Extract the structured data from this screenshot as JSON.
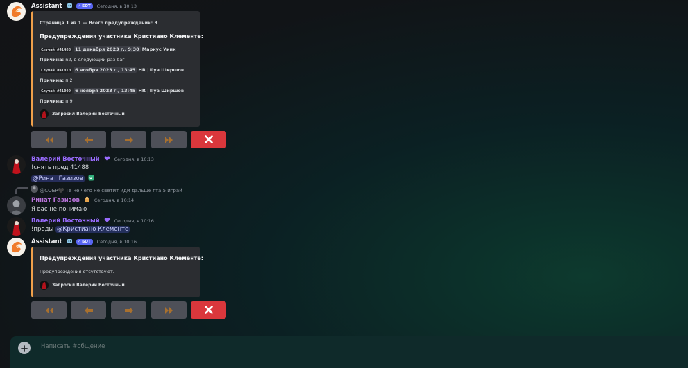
{
  "messages": {
    "m1": {
      "author": "Assistant",
      "bot_label": "БОТ",
      "time": "Сегодня, в 10:13"
    },
    "embed1": {
      "page_info": "Страница 1 из 1 — Всего предупреждений: 3",
      "title": "Предупреждения участника Кристиано Клементе:",
      "cases": [
        {
          "case": "Случай #41488",
          "date": "11 декабря 2023 г., 9:30",
          "moderator": "Маркус Уиик",
          "reason_label": "Причина:",
          "reason": "n2, в следующий раз баг"
        },
        {
          "case": "Случай #41010",
          "date": "6 ноября 2023 г., 13:45",
          "moderator": "HR | Ilya Ширшов",
          "reason_label": "Причина:",
          "reason": "п.2"
        },
        {
          "case": "Случай #41009",
          "date": "6 ноября 2023 г., 13:45",
          "moderator": "HR | Ilya Ширшов",
          "reason_label": "Причина:",
          "reason": "п.9"
        }
      ],
      "footer": "Запросил Валерий Восточный"
    },
    "m2": {
      "author": "Валерий Восточный",
      "time": "Сегодня, в 10:13",
      "text": "!снять пред 41488",
      "mention": "@Ринат Газизов"
    },
    "m3": {
      "reply_author": "@СОБР🖤",
      "reply_text": "Те не чего не светит иди дальше гта 5 играй",
      "author": "Ринат Газизов",
      "time": "Сегодня, в 10:14",
      "text": "Я вас не понимаю"
    },
    "m4": {
      "author": "Валерий Восточный",
      "time": "Сегодня, в 10:16",
      "text": "!преды",
      "mention": "@Кристиано Клементе"
    },
    "m5": {
      "author": "Assistant",
      "bot_label": "БОТ",
      "time": "Сегодня, в 10:16"
    },
    "embed2": {
      "title": "Предупреждения участника Кристиано Клементе:",
      "body": "Предупреждения отсутствуют.",
      "footer": "Запросил Валерий Восточный"
    }
  },
  "buttons": [
    "first-page-icon",
    "prev-page-icon",
    "next-page-icon",
    "last-page-icon",
    "close-icon"
  ],
  "composer": {
    "placeholder": "Написать #общение"
  },
  "colors": {
    "accent_orange": "#f0a04b",
    "valeriy": "#9a6cff",
    "rinat": "#b873d9",
    "danger": "#da373c",
    "bot_badge": "#5865f2"
  }
}
